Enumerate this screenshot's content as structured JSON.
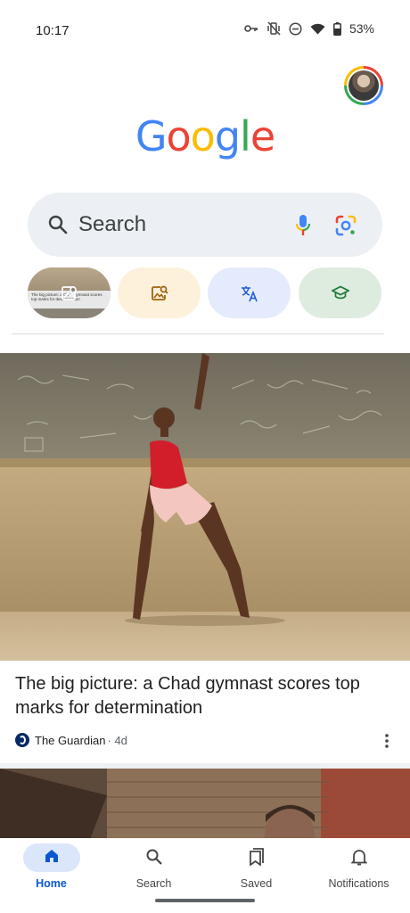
{
  "status_bar": {
    "time": "10:17",
    "battery": "53%"
  },
  "logo": {
    "letters": [
      "G",
      "o",
      "o",
      "g",
      "l",
      "e"
    ],
    "colors": [
      "#4285f4",
      "#ea4335",
      "#fbbc05",
      "#4285f4",
      "#34a853",
      "#ea4335"
    ]
  },
  "search": {
    "placeholder": "Search"
  },
  "chips": [
    {
      "name": "screenshot-search",
      "icon": "image-search-icon",
      "preview_text": "The big picture: a Chad gymnast scores top marks for determination"
    },
    {
      "name": "image-search",
      "icon": "image-search-icon"
    },
    {
      "name": "translate",
      "icon": "translate-icon"
    },
    {
      "name": "homework",
      "icon": "school-icon"
    }
  ],
  "article": {
    "title": "The big picture: a Chad gymnast scores top marks for determination",
    "source": "The Guardian",
    "age": "· 4d"
  },
  "nav": {
    "items": [
      {
        "label": "Home",
        "icon": "home-icon",
        "active": true
      },
      {
        "label": "Search",
        "icon": "search-icon",
        "active": false
      },
      {
        "label": "Saved",
        "icon": "bookmarks-icon",
        "active": false
      },
      {
        "label": "Notifications",
        "icon": "bell-icon",
        "active": false
      }
    ]
  },
  "colors": {
    "accent": "#0b57d0",
    "search_bg": "#eceff3"
  }
}
